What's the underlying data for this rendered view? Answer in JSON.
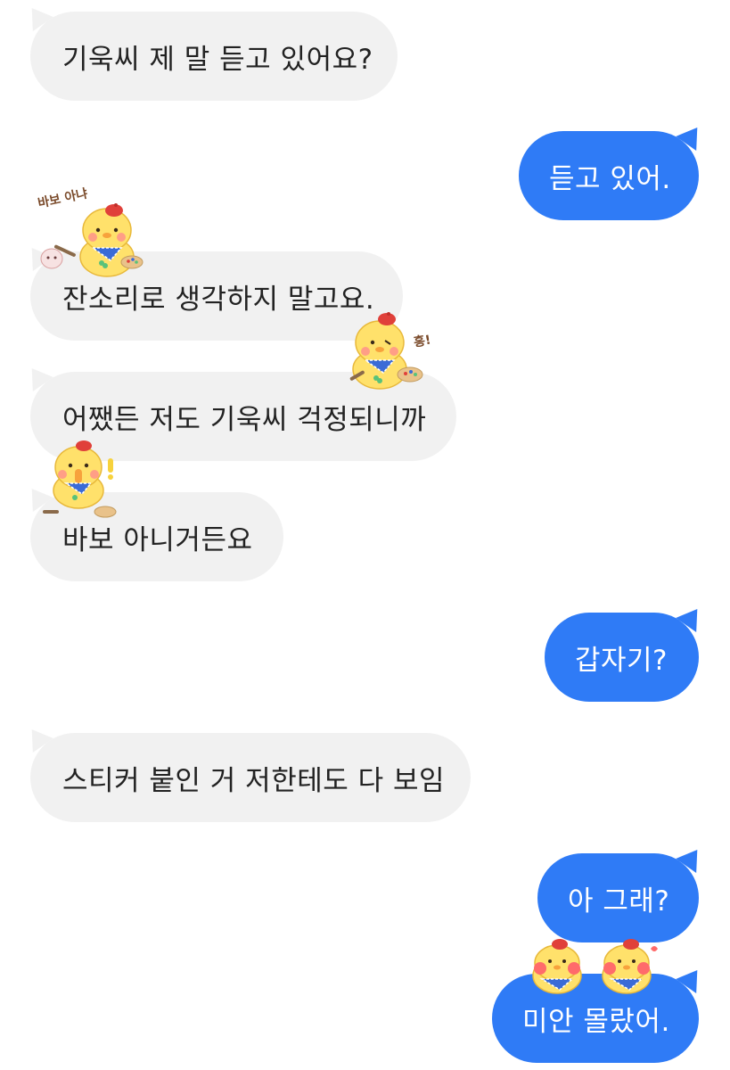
{
  "messages": [
    {
      "side": "left",
      "text": "기욱씨 제 말 듣고 있어요?"
    },
    {
      "side": "right",
      "text": "듣고 있어."
    },
    {
      "side": "left",
      "text": "잔소리로 생각하지 말고요."
    },
    {
      "side": "left",
      "text": "어쨌든 저도 기욱씨 걱정되니까"
    },
    {
      "side": "left",
      "text": "바보 아니거든요"
    },
    {
      "side": "right",
      "text": "갑자기?"
    },
    {
      "side": "left",
      "text": "스티커 붙인 거 저한테도 다 보임"
    },
    {
      "side": "right",
      "text": "아 그래?"
    },
    {
      "side": "right",
      "text": "미안 몰랐어."
    }
  ],
  "stickers": {
    "s1": {
      "caption": "바보 아냐",
      "icon": "chick-painter-sticker"
    },
    "s2": {
      "caption": "흥!",
      "icon": "chick-pouting-sticker"
    },
    "s3": {
      "caption": "!",
      "icon": "chick-surprised-sticker"
    },
    "s4": {
      "icon": "chick-crying-sticker"
    },
    "s5": {
      "icon": "chick-crying-sticker"
    }
  },
  "colors": {
    "incoming_bubble": "#f1f1f1",
    "outgoing_bubble": "#2f7bf6",
    "incoming_text": "#222222",
    "outgoing_text": "#ffffff"
  }
}
